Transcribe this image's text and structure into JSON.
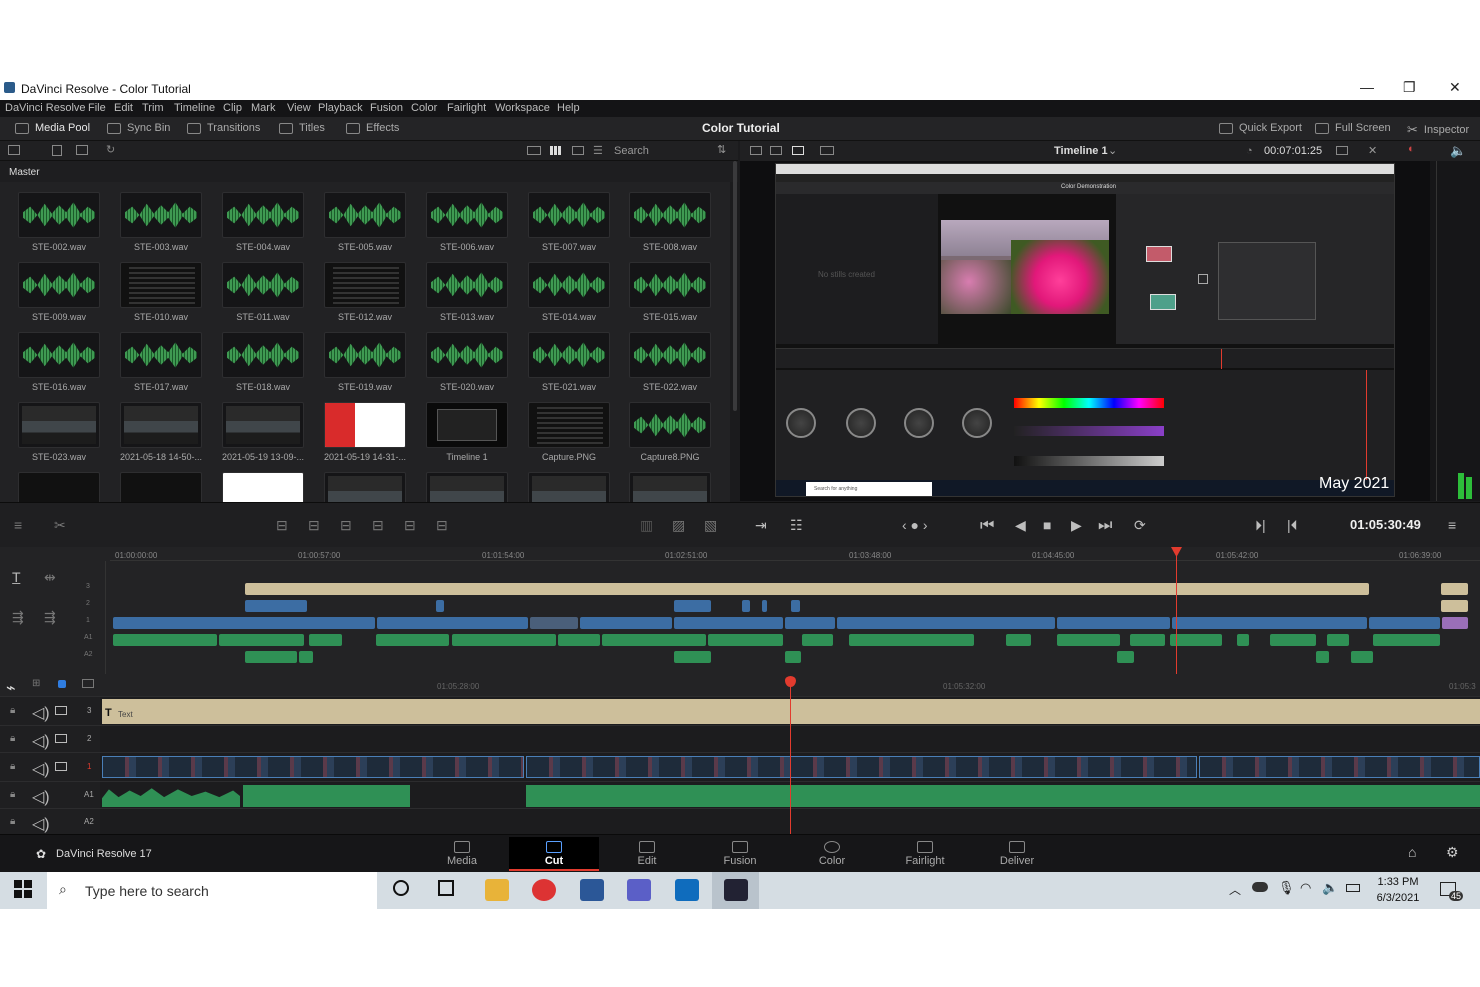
{
  "window": {
    "title": "DaVinci Resolve - Color Tutorial",
    "controls": [
      "—",
      "❐",
      "✕"
    ]
  },
  "menu": [
    "DaVinci Resolve",
    "File",
    "Edit",
    "Trim",
    "Timeline",
    "Clip",
    "Mark",
    "View",
    "Playback",
    "Fusion",
    "Color",
    "Fairlight",
    "Workspace",
    "Help"
  ],
  "toolbar": {
    "media_pool": "Media Pool",
    "sync_bin": "Sync Bin",
    "transitions": "Transitions",
    "titles": "Titles",
    "effects": "Effects",
    "project_title": "Color Tutorial",
    "quick_export": "Quick Export",
    "full_screen": "Full Screen",
    "inspector": "Inspector"
  },
  "pool": {
    "search_placeholder": "Search",
    "bin": "Master"
  },
  "clips": [
    "STE-002.wav",
    "STE-003.wav",
    "STE-004.wav",
    "STE-005.wav",
    "STE-006.wav",
    "STE-007.wav",
    "STE-008.wav",
    "STE-009.wav",
    "STE-010.wav",
    "STE-011.wav",
    "STE-012.wav",
    "STE-013.wav",
    "STE-014.wav",
    "STE-015.wav",
    "STE-016.wav",
    "STE-017.wav",
    "STE-018.wav",
    "STE-019.wav",
    "STE-020.wav",
    "STE-021.wav",
    "STE-022.wav",
    "STE-023.wav",
    "2021-05-18 14-50-...",
    "2021-05-19 13-09-...",
    "2021-05-19 14-31-...",
    "Timeline 1",
    "Capture.PNG",
    "Capture8.PNG"
  ],
  "viewer": {
    "timeline_name": "Timeline 1",
    "timecode": "00:07:01:25",
    "overlay_text": "May 2021",
    "playhead_tc": "01:05:30:49",
    "no_stills": "No stills created",
    "inner_title": "Color Demonstration",
    "taskbar_search": "Search for anything"
  },
  "ruler_upper": [
    "01:00:00:00",
    "01:00:57:00",
    "01:01:54:00",
    "01:02:51:00",
    "01:03:48:00",
    "01:04:45:00",
    "01:05:42:00",
    "01:06:39:00"
  ],
  "ruler_lower": [
    "01:05:28:00",
    "01:05:32:00",
    "01:05:3"
  ],
  "tracks_upper": [
    "3",
    "2",
    "1",
    "A1",
    "A2"
  ],
  "tracks_lower": [
    "3",
    "2",
    "1",
    "A1",
    "A2"
  ],
  "text_clip": "Text",
  "pages": [
    "Media",
    "Cut",
    "Edit",
    "Fusion",
    "Color",
    "Fairlight",
    "Deliver"
  ],
  "active_page": "Cut",
  "app_name": "DaVinci Resolve 17",
  "taskbar": {
    "search": "Type here to search",
    "time": "1:33 PM",
    "date": "6/3/2021",
    "notif": "45"
  },
  "colors": {
    "accent": "#e23b2e",
    "video_clip": "#3c6da3",
    "audio_clip": "#2f9055",
    "title_clip": "#cdbf9b",
    "active_page": "#e8e8e8"
  }
}
